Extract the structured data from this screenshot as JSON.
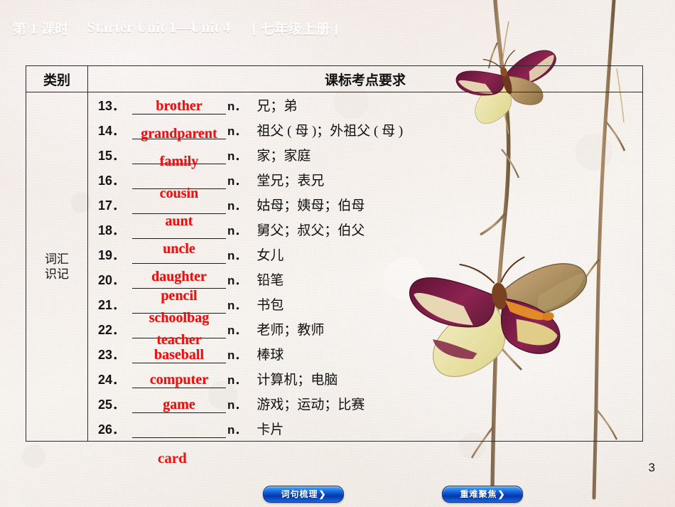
{
  "header": {
    "lesson_label": "第 1 课时",
    "unit_range": "Starter Unit 1—Unit 4",
    "grade_tag": "[ 七年级上册 ]"
  },
  "table": {
    "col_headers": {
      "category": "类别",
      "requirement": "课标考点要求"
    },
    "category_cell": "词汇\n识记",
    "category_line1": "词汇",
    "category_line2": "识记",
    "rows": [
      {
        "num": "13．",
        "answer": "brother",
        "pos": "n．",
        "meaning": "兄；弟"
      },
      {
        "num": "14．",
        "answer": "grandparent",
        "pos": "n．",
        "meaning": "祖父 ( 母 )；外祖父 ( 母 )"
      },
      {
        "num": "15．",
        "answer": "family",
        "pos": "n．",
        "meaning": "家；家庭"
      },
      {
        "num": "16．",
        "answer": "cousin",
        "pos": "n．",
        "meaning": "堂兄；表兄"
      },
      {
        "num": "17．",
        "answer": "aunt",
        "pos": "n．",
        "meaning": "姑母；姨母；伯母"
      },
      {
        "num": "18．",
        "answer": "uncle",
        "pos": "n．",
        "meaning": "舅父；叔父；伯父"
      },
      {
        "num": "19．",
        "answer": "daughter",
        "pos": "n．",
        "meaning": "女儿"
      },
      {
        "num": "20．",
        "answer": "pencil",
        "pos": "n．",
        "meaning": "铅笔"
      },
      {
        "num": "21．",
        "answer": "schoolbag",
        "pos": "n．",
        "meaning": "书包"
      },
      {
        "num": "22．",
        "answer": "teacher",
        "pos": "n．",
        "meaning": "老师；教师"
      },
      {
        "num": "23．",
        "answer": "baseball",
        "pos": "n．",
        "meaning": "棒球"
      },
      {
        "num": "24．",
        "answer": "computer",
        "pos": "n．",
        "meaning": "计算机；电脑"
      },
      {
        "num": "25．",
        "answer": "game",
        "pos": "n．",
        "meaning": "游戏；运动；比赛"
      },
      {
        "num": "26．",
        "answer": "",
        "pos": "n．",
        "meaning": "卡片"
      }
    ],
    "overflow_answer": "card"
  },
  "footer": {
    "page_number": "3",
    "buttons": [
      {
        "label": "词句梳理",
        "chevron": "❯"
      },
      {
        "label": "重难聚焦",
        "chevron": "❯"
      }
    ]
  },
  "colors": {
    "answer_red": "#ee1111",
    "title_white": "#ffffff",
    "table_border": "#2b2b2b",
    "button_blue": "#1060d8",
    "background_paper": "#f4eeea"
  },
  "decor": {
    "butterfly_top": "butterfly-icon",
    "butterfly_middle": "butterfly-icon",
    "branch_left": "branch-decoration",
    "branch_right": "branch-decoration"
  }
}
